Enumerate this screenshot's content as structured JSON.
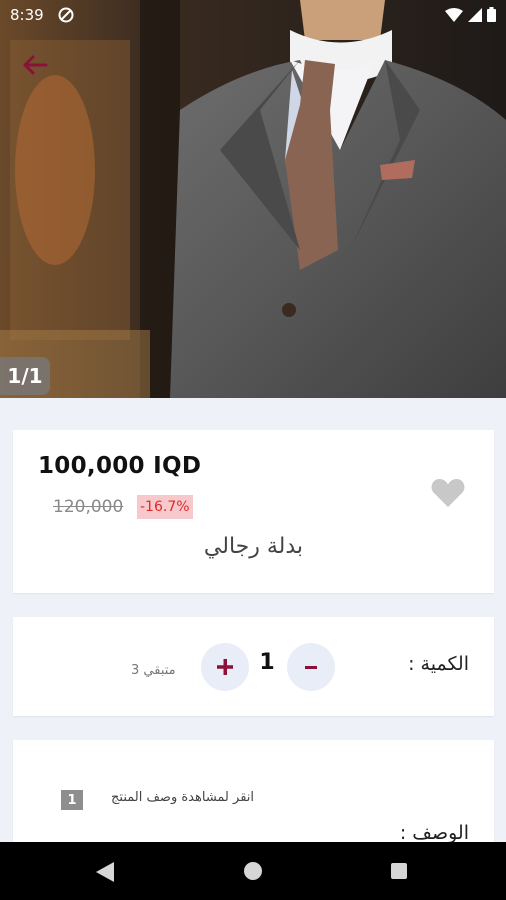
{
  "status_bar": {
    "time": "8:39"
  },
  "hero": {
    "image_counter": "1/1"
  },
  "product": {
    "price": "100,000 IQD",
    "old_price": "120,000",
    "discount": "-16.7%",
    "name": "بدلة رجالي"
  },
  "quantity": {
    "label": "الكمية :",
    "value": "1",
    "remaining": "متبقي 3",
    "minus_label": "-",
    "plus_label": "+"
  },
  "description": {
    "hint": "انقر لمشاهدة وصف المنتج",
    "badge": "1",
    "title": "الوصف :"
  },
  "colors": {
    "accent": "#8a1238",
    "discount_bg": "#f7c9cc",
    "discount_text": "#e02a2a",
    "page_bg": "#eef2f8"
  },
  "icons": [
    "dnd-icon",
    "wifi-icon",
    "signal-icon",
    "battery-icon",
    "back-arrow-icon",
    "heart-icon",
    "nav-back-icon",
    "nav-home-icon",
    "nav-recent-icon"
  ]
}
